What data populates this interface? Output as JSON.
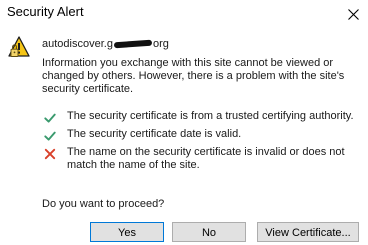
{
  "window": {
    "title": "Security Alert"
  },
  "alert": {
    "host_prefix": "autodiscover.",
    "host_visible_fragment": "g",
    "host_suffix": "org",
    "intro": "Information you exchange with this site cannot be viewed or changed by others. However, there is a problem with the site's security certificate."
  },
  "checks": [
    {
      "status": "pass",
      "icon": "green-check-icon",
      "text": "The security certificate is from a trusted certifying authority."
    },
    {
      "status": "pass",
      "icon": "green-check-icon",
      "text": "The security certificate date is valid."
    },
    {
      "status": "fail",
      "icon": "red-x-icon",
      "text": "The name on the security certificate is invalid or does not match the name of the site."
    }
  ],
  "question": "Do you want to proceed?",
  "buttons": {
    "yes": "Yes",
    "no": "No",
    "view_certificate": "View Certificate..."
  },
  "colors": {
    "pass": "#3a9a6e",
    "fail": "#d9412b",
    "default_button_border": "#0078d7"
  }
}
